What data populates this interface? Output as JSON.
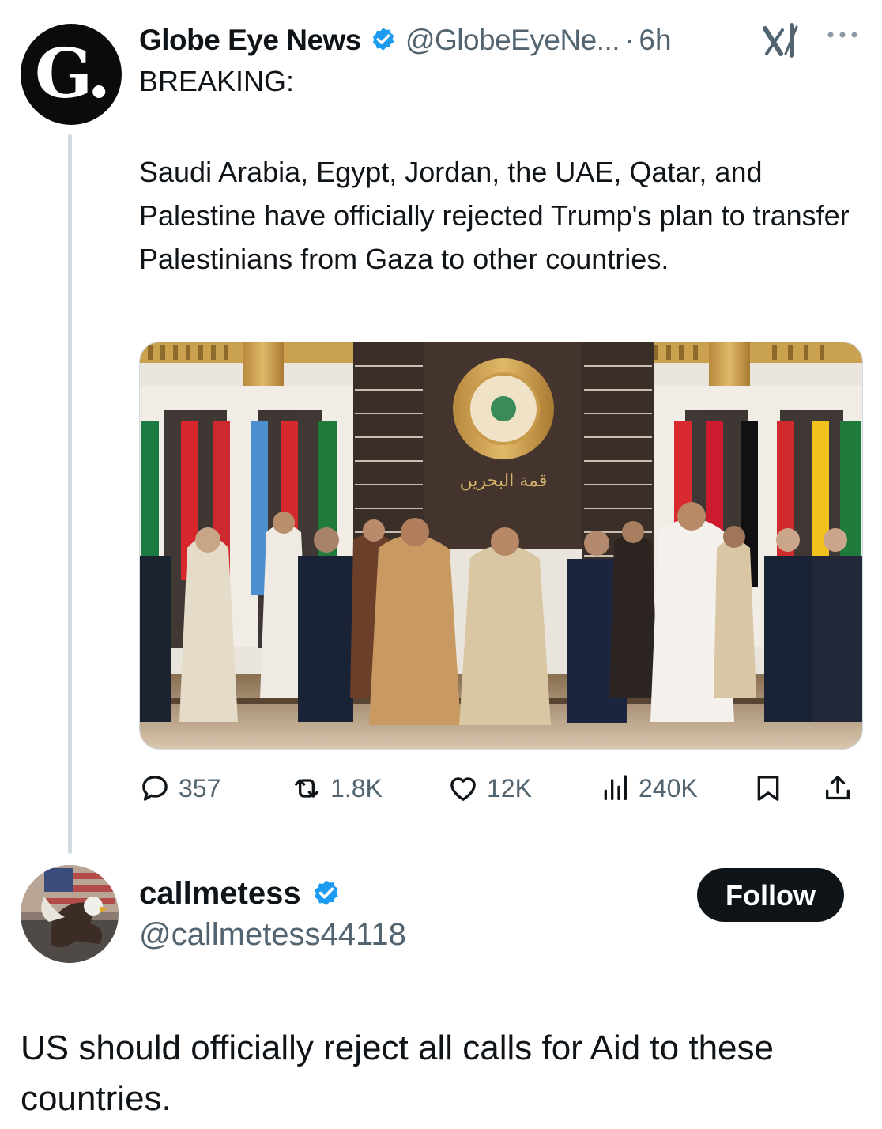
{
  "original_tweet": {
    "avatar_letter": "G.",
    "author_name": "Globe Eye News",
    "handle": "@GlobeEyeNe...",
    "separator": "·",
    "time": "6h",
    "label": "BREAKING:",
    "body": "Saudi Arabia, Egypt, Jordan, the UAE, Qatar, and Palestine have officially rejected Trump's plan to transfer Palestinians from Gaza to other countries.",
    "photo_caption_arabic": "قمة البحرين",
    "actions": {
      "replies": "357",
      "reposts": "1.8K",
      "likes": "12K",
      "views": "240K"
    },
    "icons": [
      "verified-badge-icon",
      "x-grok-icon",
      "more-icon",
      "reply-icon",
      "repost-icon",
      "like-icon",
      "views-icon",
      "bookmark-icon",
      "share-icon"
    ]
  },
  "reply": {
    "author_name": "callmetess",
    "handle": "@callmetess44118",
    "follow_label": "Follow",
    "body": "US should officially reject all calls for Aid to these countries."
  },
  "colors": {
    "text": "#0f1419",
    "secondary": "#536471",
    "verified": "#1d9bf0",
    "follow_bg": "#0f1419"
  }
}
